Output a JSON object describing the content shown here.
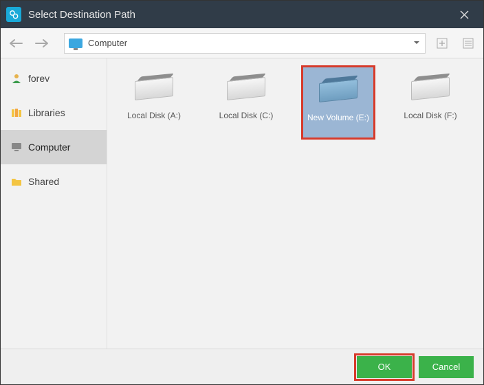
{
  "titlebar": {
    "title": "Select Destination Path"
  },
  "toolbar": {
    "path_label": "Computer"
  },
  "sidebar": {
    "items": [
      {
        "label": "forev"
      },
      {
        "label": "Libraries"
      },
      {
        "label": "Computer"
      },
      {
        "label": "Shared"
      }
    ],
    "selected_index": 2
  },
  "drives": [
    {
      "label": "Local Disk (A:)",
      "selected": false
    },
    {
      "label": "Local Disk (C:)",
      "selected": false
    },
    {
      "label": "New Volume (E:)",
      "selected": true
    },
    {
      "label": "Local Disk (F:)",
      "selected": false
    }
  ],
  "footer": {
    "ok_label": "OK",
    "cancel_label": "Cancel"
  },
  "colors": {
    "accent": "#3bb24a",
    "highlight_border": "#d73a2a",
    "titlebar": "#303c48"
  }
}
